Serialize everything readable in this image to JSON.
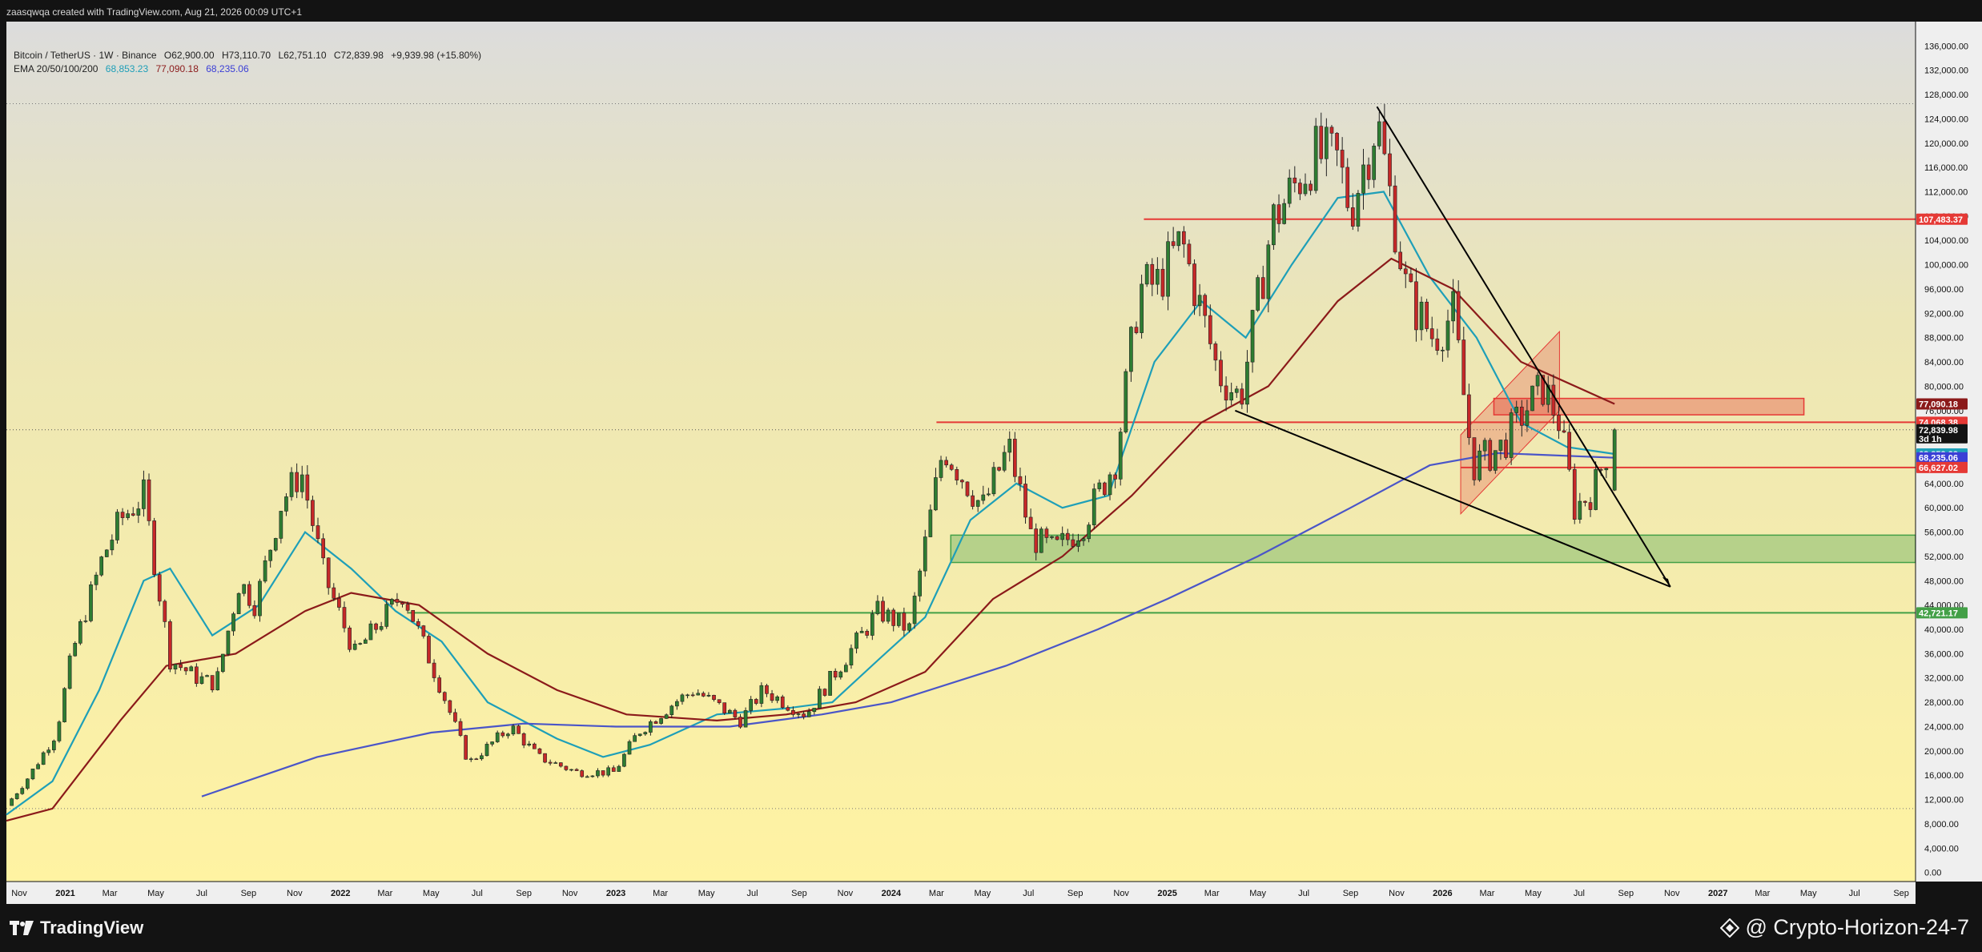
{
  "header": {
    "credit": "zaasqwqa created with TradingView.com, Aug 21, 2026 00:09 UTC+1",
    "symbol_line": "Bitcoin / TetherUS · 1W · Binance",
    "ohlc": {
      "open": "O62,900.00",
      "high": "H73,110.70",
      "low": "L62,751.10",
      "close": "C72,839.98",
      "change": "+9,939.98 (+15.80%)"
    },
    "ema_label": "EMA 20/50/100/200",
    "ema_values": [
      "68,853.23",
      "77,090.18",
      "68,235.06"
    ]
  },
  "footer": {
    "brand": "TradingView",
    "watermark": "@ Crypto-Horizon-24-7"
  },
  "colors": {
    "up": "#2e7d32",
    "down": "#c62828",
    "ema20": "#1e9fb8",
    "ema50": "#8b1a1a",
    "ema200": "#4a55c8",
    "resistance": "#e53935",
    "support": "#43a047",
    "trend": "#000000",
    "bg_top": "#dcdcdc",
    "bg_bottom": "#fff2a0"
  },
  "chart_data": {
    "type": "candlestick",
    "symbol": "BTCUSDT",
    "interval": "1W",
    "ylim": [
      -1500,
      140000
    ],
    "xlim": [
      "2020-10-15",
      "2027-09-20"
    ],
    "y_ticks": [
      "136,000.00",
      "132,000.00",
      "128,000.00",
      "124,000.00",
      "120,000.00",
      "116,000.00",
      "112,000.00",
      "108,000.00",
      "104,000.00",
      "100,000.00",
      "96,000.00",
      "92,000.00",
      "88,000.00",
      "84,000.00",
      "80,000.00",
      "76,000.00",
      "72,000.00",
      "68,000.00",
      "64,000.00",
      "60,000.00",
      "56,000.00",
      "52,000.00",
      "48,000.00",
      "44,000.00",
      "40,000.00",
      "36,000.00",
      "32,000.00",
      "28,000.00",
      "24,000.00",
      "20,000.00",
      "16,000.00",
      "12,000.00",
      "8,000.00",
      "4,000.00",
      "0.00"
    ],
    "x_ticks": [
      {
        "date": "2020-11-01",
        "label": "Nov"
      },
      {
        "date": "2021-01-01",
        "label": "2021"
      },
      {
        "date": "2021-03-01",
        "label": "Mar"
      },
      {
        "date": "2021-05-01",
        "label": "May"
      },
      {
        "date": "2021-07-01",
        "label": "Jul"
      },
      {
        "date": "2021-09-01",
        "label": "Sep"
      },
      {
        "date": "2021-11-01",
        "label": "Nov"
      },
      {
        "date": "2022-01-01",
        "label": "2022"
      },
      {
        "date": "2022-03-01",
        "label": "Mar"
      },
      {
        "date": "2022-05-01",
        "label": "May"
      },
      {
        "date": "2022-07-01",
        "label": "Jul"
      },
      {
        "date": "2022-09-01",
        "label": "Sep"
      },
      {
        "date": "2022-11-01",
        "label": "Nov"
      },
      {
        "date": "2023-01-01",
        "label": "2023"
      },
      {
        "date": "2023-03-01",
        "label": "Mar"
      },
      {
        "date": "2023-05-01",
        "label": "May"
      },
      {
        "date": "2023-07-01",
        "label": "Jul"
      },
      {
        "date": "2023-09-01",
        "label": "Sep"
      },
      {
        "date": "2023-11-01",
        "label": "Nov"
      },
      {
        "date": "2024-01-01",
        "label": "2024"
      },
      {
        "date": "2024-03-01",
        "label": "Mar"
      },
      {
        "date": "2024-05-01",
        "label": "May"
      },
      {
        "date": "2024-07-01",
        "label": "Jul"
      },
      {
        "date": "2024-09-01",
        "label": "Sep"
      },
      {
        "date": "2024-11-01",
        "label": "Nov"
      },
      {
        "date": "2025-01-01",
        "label": "2025"
      },
      {
        "date": "2025-03-01",
        "label": "Mar"
      },
      {
        "date": "2025-05-01",
        "label": "May"
      },
      {
        "date": "2025-07-01",
        "label": "Jul"
      },
      {
        "date": "2025-09-01",
        "label": "Sep"
      },
      {
        "date": "2025-11-01",
        "label": "Nov"
      },
      {
        "date": "2026-01-01",
        "label": "2026"
      },
      {
        "date": "2026-03-01",
        "label": "Mar"
      },
      {
        "date": "2026-05-01",
        "label": "May"
      },
      {
        "date": "2026-07-01",
        "label": "Jul"
      },
      {
        "date": "2026-09-01",
        "label": "Sep"
      },
      {
        "date": "2026-11-01",
        "label": "Nov"
      },
      {
        "date": "2027-01-01",
        "label": "2027"
      },
      {
        "date": "2027-03-01",
        "label": "Mar"
      },
      {
        "date": "2027-05-01",
        "label": "May"
      },
      {
        "date": "2027-07-01",
        "label": "Jul"
      },
      {
        "date": "2027-09-01",
        "label": "Sep"
      }
    ],
    "price_path": [
      [
        "2020-10-15",
        11000
      ],
      [
        "2020-11-15",
        16000
      ],
      [
        "2020-12-20",
        23000
      ],
      [
        "2021-01-10",
        36000
      ],
      [
        "2021-02-20",
        52000
      ],
      [
        "2021-03-15",
        58000
      ],
      [
        "2021-04-15",
        62000
      ],
      [
        "2021-05-20",
        35000
      ],
      [
        "2021-06-25",
        32000
      ],
      [
        "2021-07-20",
        31000
      ],
      [
        "2021-08-20",
        48000
      ],
      [
        "2021-09-10",
        44000
      ],
      [
        "2021-10-15",
        61000
      ],
      [
        "2021-11-10",
        66000
      ],
      [
        "2021-12-10",
        49000
      ],
      [
        "2022-01-20",
        36000
      ],
      [
        "2022-03-25",
        46000
      ],
      [
        "2022-05-15",
        30000
      ],
      [
        "2022-06-20",
        18000
      ],
      [
        "2022-08-15",
        24000
      ],
      [
        "2022-09-20",
        19000
      ],
      [
        "2022-11-10",
        16500
      ],
      [
        "2022-12-30",
        16500
      ],
      [
        "2023-01-30",
        23000
      ],
      [
        "2023-03-20",
        28000
      ],
      [
        "2023-04-15",
        30000
      ],
      [
        "2023-06-15",
        25000
      ],
      [
        "2023-07-15",
        30000
      ],
      [
        "2023-09-10",
        26000
      ],
      [
        "2023-10-25",
        34000
      ],
      [
        "2023-12-15",
        43000
      ],
      [
        "2024-01-25",
        40000
      ],
      [
        "2024-03-10",
        70000
      ],
      [
        "2024-05-01",
        60000
      ],
      [
        "2024-06-05",
        70000
      ],
      [
        "2024-07-05",
        55000
      ],
      [
        "2024-08-05",
        53000
      ],
      [
        "2024-09-10",
        57000
      ],
      [
        "2024-10-25",
        68000
      ],
      [
        "2024-11-25",
        96000
      ],
      [
        "2024-12-20",
        97000
      ],
      [
        "2025-01-20",
        104000
      ],
      [
        "2025-03-10",
        82000
      ],
      [
        "2025-04-08",
        78000
      ],
      [
        "2025-05-20",
        107000
      ],
      [
        "2025-07-14",
        118000
      ],
      [
        "2025-08-15",
        117000
      ],
      [
        "2025-09-01",
        109000
      ],
      [
        "2025-10-06",
        124000
      ],
      [
        "2025-11-15",
        95000
      ],
      [
        "2025-12-20",
        88000
      ],
      [
        "2026-01-15",
        92000
      ],
      [
        "2026-02-10",
        67000
      ],
      [
        "2026-03-20",
        70000
      ],
      [
        "2026-04-20",
        76000
      ],
      [
        "2026-05-15",
        80000
      ],
      [
        "2026-06-05",
        74000
      ],
      [
        "2026-06-25",
        60000
      ],
      [
        "2026-07-20",
        62900
      ],
      [
        "2026-08-17",
        72839.98
      ]
    ],
    "last_candle": {
      "open": 62900.0,
      "high": 73110.7,
      "low": 62751.1,
      "close": 72839.98
    },
    "ema_series": [
      {
        "name": "EMA 20",
        "color": "#1e9fb8",
        "points": [
          [
            "2020-10-15",
            9500
          ],
          [
            "2020-12-15",
            15000
          ],
          [
            "2021-02-15",
            30000
          ],
          [
            "2021-04-15",
            48000
          ],
          [
            "2021-05-20",
            50000
          ],
          [
            "2021-07-15",
            39000
          ],
          [
            "2021-09-15",
            44000
          ],
          [
            "2021-11-15",
            56000
          ],
          [
            "2022-01-15",
            50000
          ],
          [
            "2022-03-15",
            43000
          ],
          [
            "2022-05-15",
            38000
          ],
          [
            "2022-07-15",
            28000
          ],
          [
            "2022-10-15",
            22000
          ],
          [
            "2022-12-15",
            19000
          ],
          [
            "2023-02-15",
            21000
          ],
          [
            "2023-05-15",
            26000
          ],
          [
            "2023-08-15",
            27000
          ],
          [
            "2023-10-15",
            28000
          ],
          [
            "2023-12-15",
            35000
          ],
          [
            "2024-02-15",
            42000
          ],
          [
            "2024-04-15",
            58000
          ],
          [
            "2024-06-15",
            64000
          ],
          [
            "2024-08-15",
            60000
          ],
          [
            "2024-10-15",
            62000
          ],
          [
            "2024-12-15",
            84000
          ],
          [
            "2025-02-15",
            94000
          ],
          [
            "2025-04-15",
            88000
          ],
          [
            "2025-06-15",
            100000
          ],
          [
            "2025-08-15",
            111000
          ],
          [
            "2025-10-15",
            112000
          ],
          [
            "2025-12-15",
            98000
          ],
          [
            "2026-02-15",
            88000
          ],
          [
            "2026-04-15",
            74000
          ],
          [
            "2026-06-15",
            70000
          ],
          [
            "2026-08-17",
            68853.23
          ]
        ]
      },
      {
        "name": "EMA 50",
        "color": "#8b1a1a",
        "points": [
          [
            "2020-10-15",
            8500
          ],
          [
            "2020-12-15",
            10500
          ],
          [
            "2021-03-15",
            25000
          ],
          [
            "2021-05-15",
            34000
          ],
          [
            "2021-08-15",
            36000
          ],
          [
            "2021-11-15",
            43000
          ],
          [
            "2022-01-15",
            46000
          ],
          [
            "2022-04-15",
            44000
          ],
          [
            "2022-07-15",
            36000
          ],
          [
            "2022-10-15",
            30000
          ],
          [
            "2023-01-15",
            26000
          ],
          [
            "2023-05-15",
            25000
          ],
          [
            "2023-08-15",
            26000
          ],
          [
            "2023-11-15",
            28000
          ],
          [
            "2024-02-15",
            33000
          ],
          [
            "2024-05-15",
            45000
          ],
          [
            "2024-08-15",
            52000
          ],
          [
            "2024-11-15",
            62000
          ],
          [
            "2025-02-15",
            74000
          ],
          [
            "2025-05-15",
            80000
          ],
          [
            "2025-08-15",
            94000
          ],
          [
            "2025-10-25",
            101000
          ],
          [
            "2026-01-15",
            96000
          ],
          [
            "2026-04-15",
            84000
          ],
          [
            "2026-08-17",
            77090.18
          ]
        ]
      },
      {
        "name": "EMA 200",
        "color": "#4a55c8",
        "points": [
          [
            "2021-07-01",
            12500
          ],
          [
            "2021-12-01",
            19000
          ],
          [
            "2022-05-01",
            23000
          ],
          [
            "2022-09-01",
            24500
          ],
          [
            "2023-01-01",
            24000
          ],
          [
            "2023-06-01",
            24000
          ],
          [
            "2023-10-01",
            26000
          ],
          [
            "2024-01-01",
            28000
          ],
          [
            "2024-06-01",
            34000
          ],
          [
            "2024-10-01",
            40000
          ],
          [
            "2025-01-01",
            45000
          ],
          [
            "2025-05-01",
            52000
          ],
          [
            "2025-09-01",
            60000
          ],
          [
            "2025-12-15",
            67000
          ],
          [
            "2026-03-15",
            69000
          ],
          [
            "2026-08-17",
            68235.06
          ]
        ]
      }
    ],
    "horizontal_lines": [
      {
        "price": 107483.37,
        "from": "2024-12-01",
        "color": "#e53935"
      },
      {
        "price": 74068.38,
        "from": "2024-03-01",
        "color": "#e53935"
      },
      {
        "price": 66627.02,
        "from": "2026-01-25",
        "color": "#e53935"
      },
      {
        "price": 42721.17,
        "from": "2022-04-01",
        "color": "#43a047"
      }
    ],
    "zones": [
      {
        "from": "2024-03-20",
        "to": "2027-09-20",
        "low": 51000,
        "high": 55500,
        "color": "#43a047"
      },
      {
        "from": "2026-03-10",
        "to": "2027-04-25",
        "low": 75300,
        "high": 78000,
        "color": "#e53935"
      }
    ],
    "channel": {
      "points": [
        [
          "2026-01-25",
          59000
        ],
        [
          "2026-01-25",
          72000
        ],
        [
          "2026-06-05",
          89000
        ],
        [
          "2026-06-05",
          76000
        ]
      ],
      "color": "#e53935"
    },
    "trendlines": [
      {
        "from": [
          "2025-10-06",
          126000
        ],
        "to": [
          "2026-10-30",
          47000
        ],
        "color": "#000000"
      },
      {
        "from": [
          "2025-04-01",
          76000
        ],
        "to": [
          "2026-10-30",
          47000
        ],
        "color": "#000000"
      }
    ],
    "price_badges": [
      {
        "value": "107,483.37",
        "price": 107483.37,
        "bg": "#e53935",
        "fg": "#ffffff"
      },
      {
        "value": "77,090.18",
        "price": 77090.18,
        "bg": "#8b1a1a",
        "fg": "#ffffff"
      },
      {
        "value": "74,068.38",
        "price": 74068.38,
        "bg": "#e53935",
        "fg": "#ffffff"
      },
      {
        "value": "72,839.98",
        "sub": "3d 1h",
        "price": 72839.98,
        "bg": "#131313",
        "fg": "#ffffff"
      },
      {
        "value": "68,853.23",
        "price": 68853.23,
        "bg": "#1e9fb8",
        "fg": "#ffffff"
      },
      {
        "value": "68,235.06",
        "price": 68235.06,
        "bg": "#3b3fd6",
        "fg": "#ffffff"
      },
      {
        "value": "66,627.02",
        "price": 66627.02,
        "bg": "#e53935",
        "fg": "#ffffff"
      },
      {
        "value": "42,721.17",
        "price": 42721.17,
        "bg": "#43a047",
        "fg": "#ffffff"
      }
    ]
  }
}
